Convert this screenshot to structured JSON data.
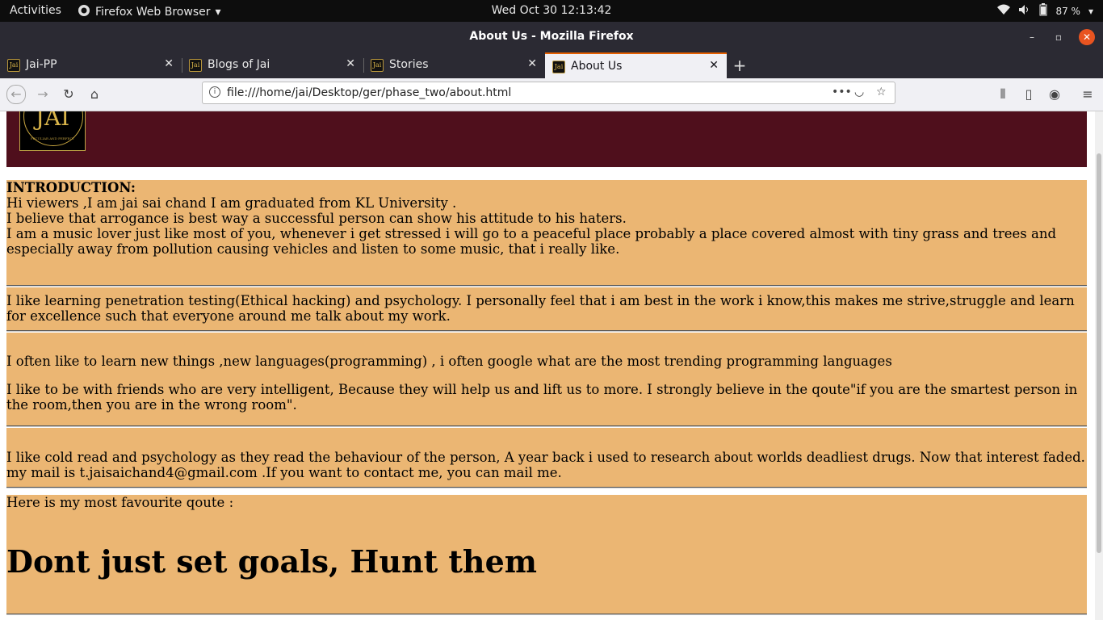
{
  "system_bar": {
    "activities": "Activities",
    "app_name": "Firefox Web Browser",
    "clock": "Wed Oct 30  12:13:42",
    "battery": "87 %"
  },
  "window": {
    "title": "About Us - Mozilla Firefox"
  },
  "tabs": [
    {
      "label": "Jai-PP"
    },
    {
      "label": "Blogs of Jai"
    },
    {
      "label": "Stories"
    },
    {
      "label": "About Us"
    }
  ],
  "favicon_text": "Jai",
  "address_bar": {
    "url": "file:///home/jai/Desktop/ger/phase_two/about.html"
  },
  "page": {
    "logo_text": "JAI",
    "logo_subtext": "PECULIAR AND PERFECT",
    "intro_heading": "INTRODUCTION:",
    "intro_lines": [
      "Hi viewers ,I am jai sai chand I am graduated from KL University .",
      "I believe that arrogance is best way a successful person can show his attitude to his haters.",
      "I am a music lover just like most of you, whenever i get stressed i will go to a peaceful place probably a place covered almost with tiny grass and trees and especially away from pollution causing vehicles and listen to some music, that i really like."
    ],
    "para_learning": "I like learning penetration testing(Ethical hacking) and psychology. I personally feel that i am best in the work i know,this makes me strive,struggle and learn for excellence such that everyone around me talk about my work.",
    "para_languages": "I often like to learn new things ,new languages(programming) , i often google what are the most trending programming languages",
    "para_friends": "I like to be with friends who are very intelligent, Because they will help us and lift us to more. I strongly believe in the qoute\"if you are the smartest person in the room,then you are in the wrong room\".",
    "para_coldread": "I like cold read and psychology as they read the behaviour of the person, A year back i used to research about worlds deadliest drugs. Now that interest faded. my mail is t.jaisaichand4@gmail.com .If you want to contact me, you can mail me.",
    "quote_intro": "Here is my most favourite qoute :",
    "quote": "Dont just set goals, Hunt them"
  }
}
